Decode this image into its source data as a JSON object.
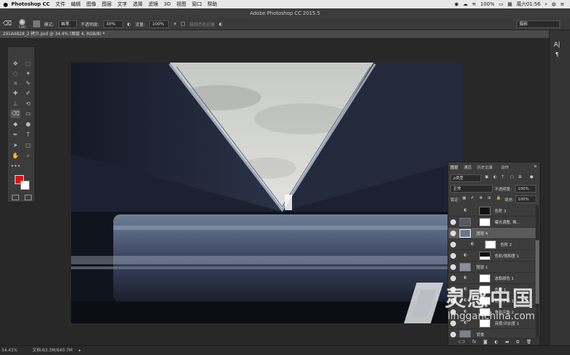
{
  "menubar": {
    "app": "Photoshop CC",
    "items": [
      "文件",
      "编辑",
      "图像",
      "图层",
      "文字",
      "选择",
      "滤镜",
      "3D",
      "视图",
      "窗口",
      "帮助"
    ],
    "battery": "100%",
    "clock": "周六01:56"
  },
  "window": {
    "title": "Adobe Photoshop CC 2015.5"
  },
  "options": {
    "brush_size": "1300",
    "mode_label": "模式:",
    "mode_value": "画笔",
    "opacity_label": "不透明度:",
    "opacity_value": "30%",
    "flow_label": "流量:",
    "flow_value": "100%",
    "erase_history": "抹到历史记录",
    "workspace": "摄影"
  },
  "document": {
    "tab": "291A4828_2 拷贝.psd @ 34.4% (图层 4, RGB/8) *"
  },
  "status": {
    "zoom": "34.41%",
    "doc": "文档:63.3M/640.7M"
  },
  "panels": {
    "tabs": [
      "图层",
      "通道",
      "历史记录",
      "动作"
    ],
    "kind_filter": "ρ类型",
    "blend_mode": "正常",
    "opacity_label": "不透明度:",
    "opacity_value": "100%",
    "lock_label": "锁定:",
    "fill_label": "填充:",
    "fill_value": "100%"
  },
  "layers": [
    {
      "name": "色阶 3",
      "thumb": "mask-dark"
    },
    {
      "name": "曝光调整, 降...",
      "thumb": "mask-white"
    },
    {
      "name": "图层 4",
      "thumb": "photo",
      "selected": true
    },
    {
      "name": "色阶 2",
      "thumb": "mask-white"
    },
    {
      "name": "色彩/饱和度 1",
      "thumb": "mask-dark"
    },
    {
      "name": "图层 1",
      "thumb": "photo"
    },
    {
      "name": "选取颜色 1",
      "thumb": "mask-white"
    },
    {
      "name": "色阶 1",
      "thumb": "mask-white"
    },
    {
      "name": "色彩平衡 1",
      "thumb": "mask-white"
    },
    {
      "name": "色彩平衡 2",
      "thumb": "mask-white"
    },
    {
      "name": "亮度/对比度 1",
      "thumb": "mask-white"
    },
    {
      "name": "背景",
      "thumb": "photo"
    }
  ],
  "watermark": {
    "brand": "灵感中国",
    "url": "lingganchina.com"
  },
  "colors": {
    "foreground": "#e0101a",
    "background": "#ffffff",
    "accent": "#4a5a7a"
  }
}
